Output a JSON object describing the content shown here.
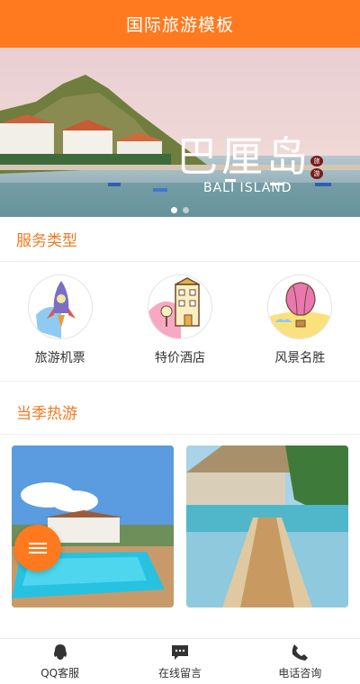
{
  "header": {
    "title": "国际旅游模板"
  },
  "banner": {
    "title": "巴厘岛",
    "subtitle": "BALI ISLAND",
    "seal_top": "旅",
    "seal_bottom": "游",
    "slide_count": 2,
    "active_slide": 1
  },
  "services": {
    "title": "服务类型",
    "items": [
      {
        "label": "旅游机票",
        "icon": "rocket-icon"
      },
      {
        "label": "特价酒店",
        "icon": "hotel-icon"
      },
      {
        "label": "风景名胜",
        "icon": "balloon-icon"
      }
    ]
  },
  "hot": {
    "title": "当季热游",
    "items": [
      {
        "label": "",
        "image": "pool-villa"
      },
      {
        "label": "",
        "image": "beach-pier"
      }
    ]
  },
  "bottom_nav": {
    "items": [
      {
        "label": "QQ客服",
        "icon": "qq-icon"
      },
      {
        "label": "在线留言",
        "icon": "message-icon"
      },
      {
        "label": "电话咨询",
        "icon": "phone-icon"
      }
    ]
  },
  "colors": {
    "accent": "#ff7a1e",
    "section_title": "#f07a22"
  }
}
